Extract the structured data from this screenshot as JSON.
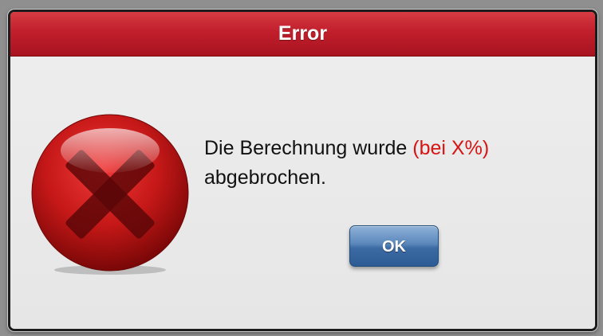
{
  "dialog": {
    "title": "Error",
    "icon": "error-x-icon",
    "message": {
      "line1_prefix": "Die Berechnung wurde ",
      "line1_highlight": "(bei X%)",
      "line2": "abgebrochen."
    },
    "ok_label": "OK"
  },
  "colors": {
    "title_bar": "#c11f2b",
    "highlight_text": "#d91414",
    "ok_button": "#4674ad",
    "icon_red": "#c51d1d"
  }
}
